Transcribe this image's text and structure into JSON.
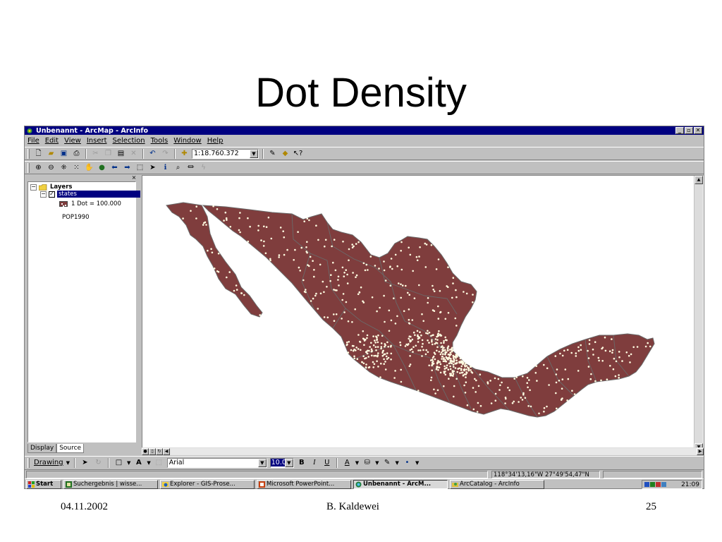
{
  "slide": {
    "title": "Dot Density",
    "footer_date": "04.11.2002",
    "footer_author": "B. Kaldewei",
    "footer_page": "25"
  },
  "window": {
    "title": "Unbenannt - ArcMap - ArcInfo",
    "controls": [
      "_",
      "▫",
      "✕"
    ]
  },
  "menu": [
    "File",
    "Edit",
    "View",
    "Insert",
    "Selection",
    "Tools",
    "Window",
    "Help"
  ],
  "standard_toolbar": {
    "scale": "1:18.760.372",
    "icons": [
      "new-icon",
      "open-icon",
      "save-icon",
      "print-icon",
      "cut-icon",
      "copy-icon",
      "paste-icon",
      "delete-icon",
      "undo-icon",
      "redo-icon",
      "add-data-icon",
      "editor-icon",
      "arctoolbox-icon",
      "whats-this-icon"
    ]
  },
  "tools_toolbar": {
    "icons": [
      "zoom-in-icon",
      "zoom-out-icon",
      "fixed-zoom-in-icon",
      "fixed-zoom-out-icon",
      "pan-icon",
      "full-extent-icon",
      "back-icon",
      "forward-icon",
      "select-features-icon",
      "select-elements-icon",
      "identify-icon",
      "find-icon",
      "measure-icon",
      "hyperlink-icon"
    ]
  },
  "toc": {
    "root": "Layers",
    "layer": "states",
    "legend_label": "1 Dot = 100.000",
    "field": "POP1990",
    "tabs": [
      "Display",
      "Source"
    ]
  },
  "map": {
    "fill_color": "#7f3d3d",
    "border_color": "#6a6a6a",
    "dot_color": "#fffbe0"
  },
  "drawing_toolbar": {
    "label": "Drawing",
    "font": "Arial",
    "font_size": "10.0",
    "bold": "B",
    "italic": "I",
    "underline": "U"
  },
  "status": {
    "coordinates": "118°34'13,16\"W  27°49'54,47\"N"
  },
  "taskbar": {
    "start": "Start",
    "tasks": [
      "Suchergebnis | wisse...",
      "Explorer - GIS-Prose...",
      "Microsoft PowerPoint...",
      "Unbenannt - ArcM...",
      "ArcCatalog - ArcInfo"
    ],
    "clock": "21:09"
  }
}
